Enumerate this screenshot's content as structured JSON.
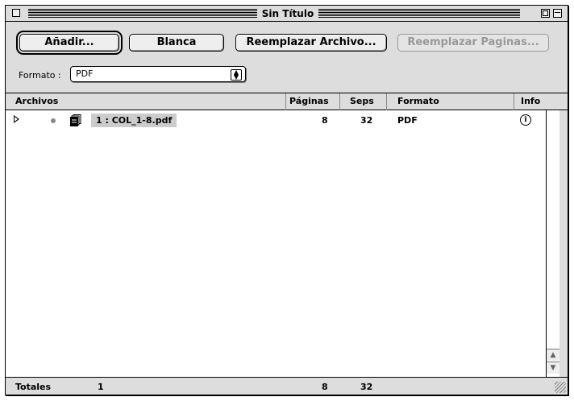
{
  "window": {
    "title": "Sin Título"
  },
  "toolbar": {
    "add_label": "Añadir...",
    "blank_label": "Blanca",
    "replace_file_label": "Reemplazar Archivo...",
    "replace_pages_label": "Reemplazar Paginas..."
  },
  "format": {
    "label": "Formato :",
    "selected": "PDF"
  },
  "columns": {
    "files": "Archivos",
    "pages": "Páginas",
    "seps": "Seps",
    "format": "Formato",
    "info": "Info"
  },
  "rows": [
    {
      "name": "1 : COL_1-8.pdf",
      "pages": "8",
      "seps": "32",
      "format": "PDF"
    }
  ],
  "totals": {
    "label": "Totales",
    "files": "1",
    "pages": "8",
    "seps": "32"
  },
  "icons": [
    "close-box-icon",
    "zoom-box-icon",
    "collapse-box-icon",
    "disclosure-triangle-icon",
    "document-icon",
    "info-icon",
    "scroll-up-icon",
    "scroll-down-icon",
    "resize-grip-icon"
  ]
}
